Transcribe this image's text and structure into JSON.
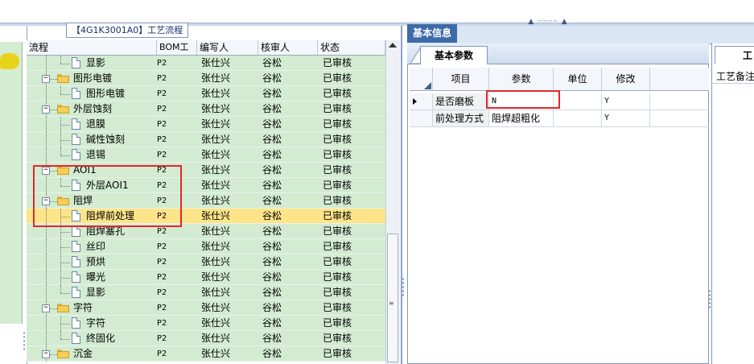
{
  "process_title": "【4G1K3001A0】工艺流程",
  "tree_columns": [
    "流程",
    "BOM工厂",
    "编写人",
    "核审人",
    "状态"
  ],
  "tree_rows": [
    {
      "label": "显影",
      "type": "file",
      "depth": 2,
      "bom": "P2",
      "writer": "张仕兴",
      "reviewer": "谷松",
      "status": "已审核"
    },
    {
      "label": "图形电镀",
      "type": "folder",
      "depth": 1,
      "bom": "P2",
      "writer": "张仕兴",
      "reviewer": "谷松",
      "status": "已审核"
    },
    {
      "label": "图形电镀",
      "type": "file",
      "depth": 2,
      "bom": "P2",
      "writer": "张仕兴",
      "reviewer": "谷松",
      "status": "已审核"
    },
    {
      "label": "外层蚀刻",
      "type": "folder",
      "depth": 1,
      "bom": "P2",
      "writer": "张仕兴",
      "reviewer": "谷松",
      "status": "已审核"
    },
    {
      "label": "退膜",
      "type": "file",
      "depth": 2,
      "bom": "P2",
      "writer": "张仕兴",
      "reviewer": "谷松",
      "status": "已审核"
    },
    {
      "label": "碱性蚀刻",
      "type": "file",
      "depth": 2,
      "bom": "P2",
      "writer": "张仕兴",
      "reviewer": "谷松",
      "status": "已审核"
    },
    {
      "label": "退锡",
      "type": "file",
      "depth": 2,
      "bom": "P2",
      "writer": "张仕兴",
      "reviewer": "谷松",
      "status": "已审核"
    },
    {
      "label": "AOI1",
      "type": "folder",
      "depth": 1,
      "bom": "P2",
      "writer": "张仕兴",
      "reviewer": "谷松",
      "status": "已审核"
    },
    {
      "label": "外层AOI1",
      "type": "file",
      "depth": 2,
      "bom": "P2",
      "writer": "张仕兴",
      "reviewer": "谷松",
      "status": "已审核"
    },
    {
      "label": "阻焊",
      "type": "folder",
      "depth": 1,
      "bom": "P2",
      "writer": "张仕兴",
      "reviewer": "谷松",
      "status": "已审核"
    },
    {
      "label": "阻焊前处理",
      "type": "file",
      "depth": 2,
      "bom": "P2",
      "writer": "张仕兴",
      "reviewer": "谷松",
      "status": "已审核",
      "selected": true
    },
    {
      "label": "阻焊塞孔",
      "type": "file",
      "depth": 2,
      "bom": "P2",
      "writer": "张仕兴",
      "reviewer": "谷松",
      "status": "已审核"
    },
    {
      "label": "丝印",
      "type": "file",
      "depth": 2,
      "bom": "P2",
      "writer": "张仕兴",
      "reviewer": "谷松",
      "status": "已审核"
    },
    {
      "label": "预烘",
      "type": "file",
      "depth": 2,
      "bom": "P2",
      "writer": "张仕兴",
      "reviewer": "谷松",
      "status": "已审核"
    },
    {
      "label": "曝光",
      "type": "file",
      "depth": 2,
      "bom": "P2",
      "writer": "张仕兴",
      "reviewer": "谷松",
      "status": "已审核"
    },
    {
      "label": "显影",
      "type": "file",
      "depth": 2,
      "bom": "P2",
      "writer": "张仕兴",
      "reviewer": "谷松",
      "status": "已审核"
    },
    {
      "label": "字符",
      "type": "folder",
      "depth": 1,
      "bom": "P2",
      "writer": "张仕兴",
      "reviewer": "谷松",
      "status": "已审核"
    },
    {
      "label": "字符",
      "type": "file",
      "depth": 2,
      "bom": "P2",
      "writer": "张仕兴",
      "reviewer": "谷松",
      "status": "已审核"
    },
    {
      "label": "终固化",
      "type": "file",
      "depth": 2,
      "bom": "P2",
      "writer": "张仕兴",
      "reviewer": "谷松",
      "status": "已审核"
    },
    {
      "label": "沉金",
      "type": "folder",
      "depth": 1,
      "bom": "P2",
      "writer": "张仕兴",
      "reviewer": "谷松",
      "status": "已审核"
    }
  ],
  "right_tab": "基本信息",
  "sub_tab": "基本参数",
  "param_columns": [
    "项目",
    "参数",
    "单位",
    "修改"
  ],
  "param_rows": [
    {
      "item": "是否磨板",
      "param": "N",
      "unit": "",
      "modify": "Y",
      "current": true
    },
    {
      "item": "前处理方式",
      "param": "阻焊超粗化",
      "unit": "",
      "modify": "Y",
      "current": false
    }
  ],
  "far_tab": "工",
  "far_label": "工艺备注",
  "expander_glyph": "−",
  "colors": {
    "row_green": "#d3ecd1",
    "selected_row": "#fde489",
    "highlight_red": "#e0282b",
    "tab_blue": "#3e6aa8"
  }
}
